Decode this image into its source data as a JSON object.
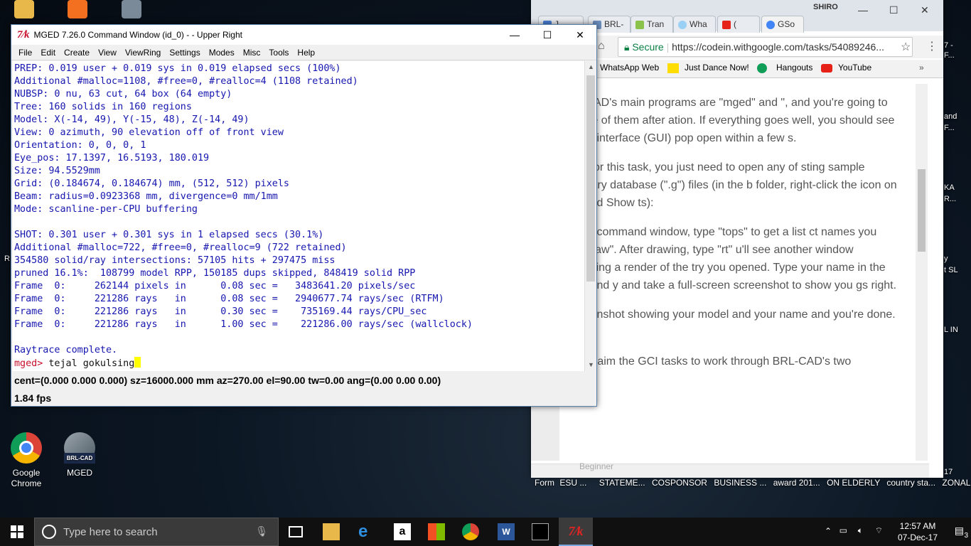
{
  "desktop": {
    "icons": [
      {
        "label_1": "Google",
        "label_2": "Chrome"
      },
      {
        "label_1": "MGED",
        "label_2": ""
      }
    ],
    "side_labels": [
      "7 -",
      "F...",
      "and",
      "F...",
      "KA",
      "R...",
      "y",
      "t SL",
      "L IN",
      "R",
      "17"
    ],
    "file_strip": [
      "Form",
      "ESU ...",
      "STATEME...",
      "COSPONSOR",
      "BUSINESS ...",
      "award 201...",
      "ON ELDERLY",
      "country sta...",
      "ZONAL QO..."
    ]
  },
  "mged": {
    "title": "MGED 7.26.0 Command Window (id_0) -  - Upper Right",
    "logo": "7⁄k",
    "menu": [
      "File",
      "Edit",
      "Create",
      "View",
      "ViewRing",
      "Settings",
      "Modes",
      "Misc",
      "Tools",
      "Help"
    ],
    "output": "PREP: 0.019 user + 0.019 sys in 0.019 elapsed secs (100%)\nAdditional #malloc=1108, #free=0, #realloc=4 (1108 retained)\nNUBSP: 0 nu, 63 cut, 64 box (64 empty)\nTree: 160 solids in 160 regions\nModel: X(-14, 49), Y(-15, 48), Z(-14, 49)\nView: 0 azimuth, 90 elevation off of front view\nOrientation: 0, 0, 0, 1\nEye_pos: 17.1397, 16.5193, 180.019\nSize: 94.5529mm\nGrid: (0.184674, 0.184674) mm, (512, 512) pixels\nBeam: radius=0.0923368 mm, divergence=0 mm/1mm\nMode: scanline-per-CPU buffering\n\nSHOT: 0.301 user + 0.301 sys in 1 elapsed secs (30.1%)\nAdditional #malloc=722, #free=0, #realloc=9 (722 retained)\n354580 solid/ray intersections: 57105 hits + 297475 miss\npruned 16.1%:  108799 model RPP, 150185 dups skipped, 848419 solid RPP\nFrame  0:     262144 pixels in      0.08 sec =   3483641.20 pixels/sec\nFrame  0:     221286 rays   in      0.08 sec =   2940677.74 rays/sec (RTFM)\nFrame  0:     221286 rays   in      0.30 sec =    735169.44 rays/CPU_sec\nFrame  0:     221286 rays   in      1.00 sec =    221286.00 rays/sec (wallclock)\n\nRaytrace complete.",
    "prompt": "mged>",
    "command": " tejal gokulsing",
    "status_line": "cent=(0.000 0.000 0.000) sz=16000.000  mm  az=270.00  el=90.00  tw=0.00  ang=(0.00 0.00 0.00)",
    "fps": "1.84 fps"
  },
  "chrome": {
    "profile": "SHIRO",
    "tabs": [
      {
        "label": "J",
        "color": "#4a7fd6"
      },
      {
        "label": "BRL-",
        "color": "#6c8fbf"
      },
      {
        "label": "Tran",
        "color": "#8bc34a"
      },
      {
        "label": "Wha",
        "color": "#9ad0f5"
      },
      {
        "label": "(",
        "color": "#e62117"
      },
      {
        "label": "GSo",
        "color": "#4285f4"
      }
    ],
    "secure_label": "Secure",
    "url": "https://codein.withgoogle.com/tasks/54089246...",
    "bookmarks": [
      "WhatsApp Web",
      "Just Dance Now!",
      "Hangouts",
      "YouTube"
    ],
    "paragraphs": [
      "BRL-CAD's main programs are \"mged\" and \", and you're going to run one of them after ation. If everything goes well, you should see al user interface (GUI) pop open within a few s.",
      "anic! For this task, you just need to open any of sting sample geometry database (\".g\") files (in the b folder, right-click the icon on Mac and Show ts):",
      "MGED command window, type \"tops\" to get a list ct names you can \"draw\". After drawing, type \"rt\" u'll see another window containing a render of the try you opened. Type your name in the command y and take a full-screen screenshot to show you gs right.",
      "a screenshot showing your model and your name and you're done. :)",
      "Next, claim the GCI tasks to work through BRL-CAD's two"
    ],
    "footer_hint": "Beginner"
  },
  "taskbar": {
    "search_placeholder": "Type here to search",
    "time": "12:57 AM",
    "date": "07-Dec-17",
    "notifications": "3"
  }
}
